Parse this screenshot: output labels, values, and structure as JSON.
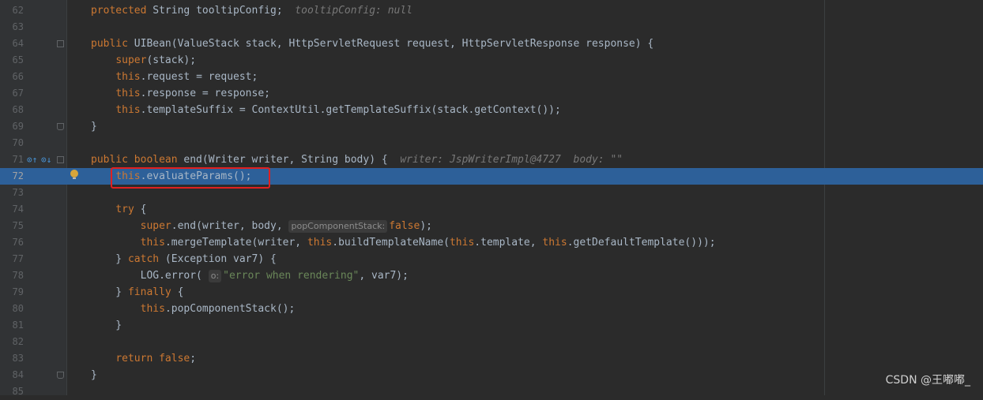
{
  "editor": {
    "lines": [
      {
        "num": "62",
        "tokens": [
          [
            "kw",
            "protected"
          ],
          [
            "t",
            " String tooltipConfig;"
          ],
          [
            "hint",
            "  tooltipConfig: null"
          ]
        ]
      },
      {
        "num": "63",
        "tokens": []
      },
      {
        "num": "64",
        "tokens": [
          [
            "kw",
            "public"
          ],
          [
            "t",
            " UIBean(ValueStack stack, HttpServletRequest request, HttpServletResponse response) {"
          ]
        ]
      },
      {
        "num": "65",
        "tokens": [
          [
            "t",
            "    "
          ],
          [
            "kw",
            "super"
          ],
          [
            "t",
            "(stack);"
          ]
        ]
      },
      {
        "num": "66",
        "tokens": [
          [
            "t",
            "    "
          ],
          [
            "kw",
            "this"
          ],
          [
            "t",
            ".request = request;"
          ]
        ]
      },
      {
        "num": "67",
        "tokens": [
          [
            "t",
            "    "
          ],
          [
            "kw",
            "this"
          ],
          [
            "t",
            ".response = response;"
          ]
        ]
      },
      {
        "num": "68",
        "tokens": [
          [
            "t",
            "    "
          ],
          [
            "kw",
            "this"
          ],
          [
            "t",
            ".templateSuffix = ContextUtil.getTemplateSuffix(stack.getContext());"
          ]
        ]
      },
      {
        "num": "69",
        "tokens": [
          [
            "t",
            "}"
          ]
        ]
      },
      {
        "num": "70",
        "tokens": []
      },
      {
        "num": "71",
        "tokens": [
          [
            "kw",
            "public boolean"
          ],
          [
            "t",
            " end(Writer writer, String body) {"
          ],
          [
            "hint",
            "  writer: JspWriterImpl@4727  body: \"\""
          ]
        ]
      },
      {
        "num": "72",
        "tokens": [
          [
            "t",
            "    "
          ],
          [
            "kw",
            "this"
          ],
          [
            "t",
            ".evaluateParams();"
          ]
        ]
      },
      {
        "num": "73",
        "tokens": []
      },
      {
        "num": "74",
        "tokens": [
          [
            "t",
            "    "
          ],
          [
            "kw",
            "try"
          ],
          [
            "t",
            " {"
          ]
        ]
      },
      {
        "num": "75",
        "tokens": [
          [
            "t",
            "        "
          ],
          [
            "kw",
            "super"
          ],
          [
            "t",
            ".end(writer, body, "
          ],
          [
            "phint",
            "popComponentStack:"
          ],
          [
            "kw",
            "false"
          ],
          [
            "t",
            ");"
          ]
        ]
      },
      {
        "num": "76",
        "tokens": [
          [
            "t",
            "        "
          ],
          [
            "kw",
            "this"
          ],
          [
            "t",
            ".mergeTemplate(writer, "
          ],
          [
            "kw",
            "this"
          ],
          [
            "t",
            ".buildTemplateName("
          ],
          [
            "kw",
            "this"
          ],
          [
            "t",
            ".template, "
          ],
          [
            "kw",
            "this"
          ],
          [
            "t",
            ".getDefaultTemplate()));"
          ]
        ]
      },
      {
        "num": "77",
        "tokens": [
          [
            "t",
            "    } "
          ],
          [
            "kw",
            "catch"
          ],
          [
            "t",
            " (Exception var7) {"
          ]
        ]
      },
      {
        "num": "78",
        "tokens": [
          [
            "t",
            "        LOG.error( "
          ],
          [
            "phint",
            "o:"
          ],
          [
            "str",
            "\"error when rendering\""
          ],
          [
            "t",
            ", var7);"
          ]
        ]
      },
      {
        "num": "79",
        "tokens": [
          [
            "t",
            "    } "
          ],
          [
            "kw",
            "finally"
          ],
          [
            "t",
            " {"
          ]
        ]
      },
      {
        "num": "80",
        "tokens": [
          [
            "t",
            "        "
          ],
          [
            "kw",
            "this"
          ],
          [
            "t",
            ".popComponentStack();"
          ]
        ]
      },
      {
        "num": "81",
        "tokens": [
          [
            "t",
            "    }"
          ]
        ]
      },
      {
        "num": "82",
        "tokens": []
      },
      {
        "num": "83",
        "tokens": [
          [
            "t",
            "    "
          ],
          [
            "kw",
            "return false"
          ],
          [
            "t",
            ";"
          ]
        ]
      },
      {
        "num": "84",
        "tokens": [
          [
            "t",
            "}"
          ]
        ]
      },
      {
        "num": "85",
        "tokens": []
      }
    ],
    "execution_line": "72",
    "folds": [
      "64",
      "69",
      "71",
      "84"
    ],
    "colors": {
      "background": "#2b2b2b",
      "keyword": "#cc7832",
      "text": "#a9b7c6",
      "string": "#6a8759",
      "execution_line": "#2d6099",
      "annotation_box": "#e02020"
    }
  },
  "watermark": "CSDN @王嘟嘟_"
}
